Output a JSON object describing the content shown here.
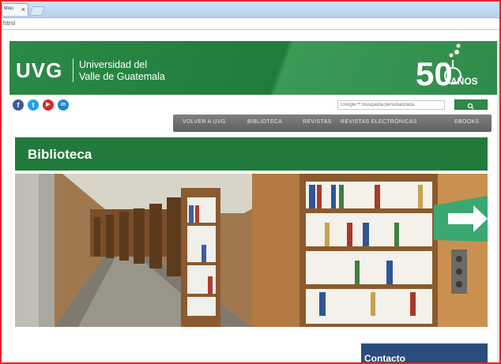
{
  "browser": {
    "tab_title": "tinici",
    "tab_close": "×",
    "address": "html"
  },
  "header": {
    "logo": "UVG",
    "university_line1": "Universidad del",
    "university_line2": "Valle de Guatemala",
    "anniversary_number": "50",
    "anniversary_text": "AÑOS"
  },
  "social": {
    "facebook": "f",
    "twitter": "t",
    "youtube": "▶",
    "linkedin": "in"
  },
  "search": {
    "placeholder": "Google™ Búsqueda personalizada"
  },
  "nav": {
    "items": [
      "VOLVER A UVG",
      "BIBLIOTECA",
      "REVISTAS",
      "REVISTAS ELECTRÓNICAS",
      "EBOOKS"
    ]
  },
  "page": {
    "title": "Biblioteca"
  },
  "contact": {
    "title": "Contacto"
  },
  "colors": {
    "header_green": "#217c3c",
    "nav_gray": "#6e6e6e",
    "contact_blue": "#2b4d7e",
    "frame_red": "#e0262b"
  }
}
